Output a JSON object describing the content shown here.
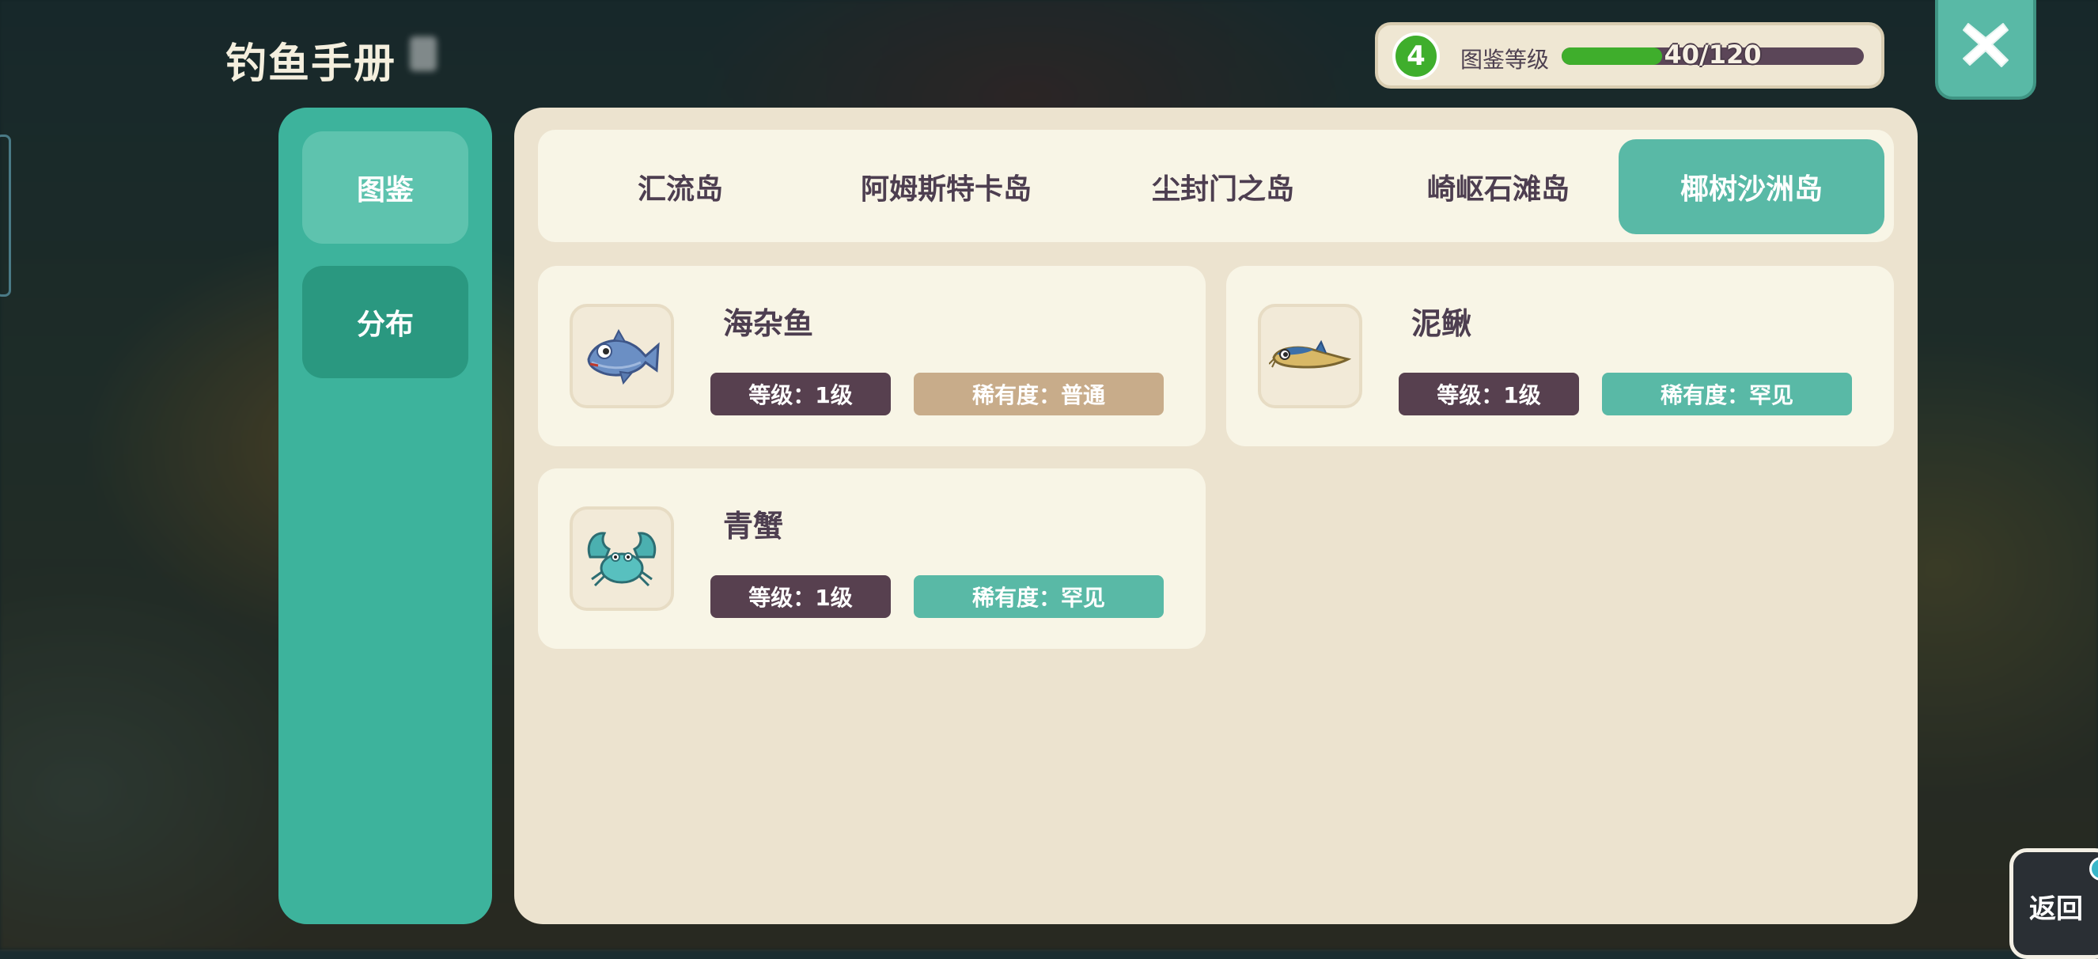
{
  "header": {
    "title": "钓鱼手册"
  },
  "collection_level": {
    "level": "4",
    "label": "图鉴等级",
    "progress_text": "40/120",
    "progress_fraction": 0.333,
    "accent": "#3fae2c"
  },
  "sidebar": {
    "tabs": [
      {
        "label": "图鉴"
      },
      {
        "label": "分布"
      }
    ]
  },
  "islands": {
    "tabs": [
      {
        "label": "汇流岛"
      },
      {
        "label": "阿姆斯特卡岛"
      },
      {
        "label": "尘封门之岛"
      },
      {
        "label": "崎岖石滩岛"
      },
      {
        "label": "椰树沙洲岛"
      }
    ],
    "active": "椰树沙洲岛"
  },
  "fish": [
    {
      "name": "海杂鱼",
      "level": "等级：1级",
      "rarity": "稀有度：普通",
      "icon": "fish-icon"
    },
    {
      "name": "泥鳅",
      "level": "等级：1级",
      "rarity": "稀有度：罕见",
      "icon": "loach-icon"
    },
    {
      "name": "青蟹",
      "level": "等级：1级",
      "rarity": "稀有度：罕见",
      "icon": "crab-icon"
    }
  ],
  "back_button": {
    "label": "返回"
  },
  "colors": {
    "teal": "#59b9a6",
    "sidebar": "#3db39c",
    "panel": "#ece3cf",
    "card": "#f8f5e6",
    "dark_tag": "#57404f",
    "common_tag": "#c8ac8a"
  }
}
